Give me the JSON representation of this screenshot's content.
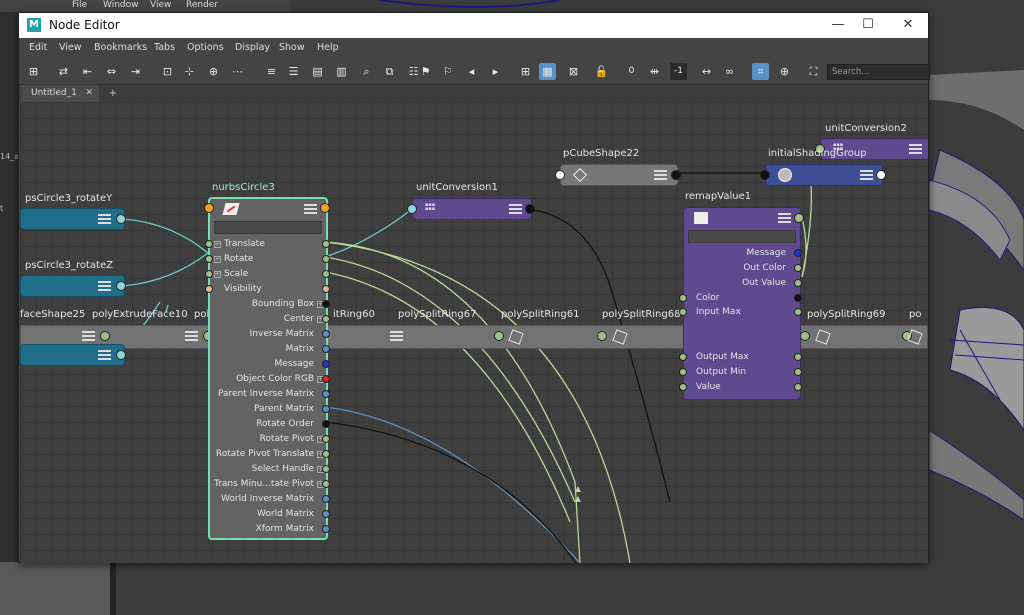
{
  "background_menu": {
    "file": "File",
    "window": "Window",
    "view": "View",
    "render": "Render"
  },
  "background_left_text": [
    "14_a",
    "t"
  ],
  "window": {
    "title": "Node Editor",
    "minimize": "—",
    "maximize": "☐",
    "close": "✕",
    "logo": "M"
  },
  "menu": [
    "Edit",
    "View",
    "Bookmarks",
    "Tabs",
    "Options",
    "Display",
    "Show",
    "Help"
  ],
  "toolbar": {
    "minus_one": "-1",
    "zero": "0",
    "search_placeholder": "Search..."
  },
  "tabs": {
    "tab1_label": "Untitled_1",
    "tab1_close": "✕",
    "add": "+"
  },
  "nodes": {
    "rotateY": "psCircle3_rotateY",
    "rotateZ": "psCircle3_rotateZ",
    "faceShape": "faceShape25",
    "extrude": "polyExtrudeFace10",
    "poly_partial": "pol",
    "nurbs": "nurbsCircle3",
    "unitConv1": "unitConversion1",
    "pCube": "pCubeShape22",
    "unitConv2": "unitConversion2",
    "initialSG": "initialShadingGroup",
    "remap": "remapValue1",
    "rings": [
      "itRing60",
      "polySplitRing67",
      "polySplitRing61",
      "polySplitRing68",
      "polySplitRing62",
      "polySplitRing69",
      "po"
    ],
    "input_min_partial": "Input Min"
  },
  "nurbs_rows": [
    {
      "label": "Translate",
      "side": "left",
      "plus": true
    },
    {
      "label": "Rotate",
      "side": "left",
      "plus": true
    },
    {
      "label": "Scale",
      "side": "left",
      "plus": true
    },
    {
      "label": "Visibility",
      "side": "left",
      "plus": false
    },
    {
      "label": "Bounding Box",
      "side": "right",
      "plus": true
    },
    {
      "label": "Center",
      "side": "right",
      "plus": true
    },
    {
      "label": "Inverse Matrix",
      "side": "right",
      "plus": false
    },
    {
      "label": "Matrix",
      "side": "right",
      "plus": false
    },
    {
      "label": "Message",
      "side": "right",
      "plus": false
    },
    {
      "label": "Object Color RGB",
      "side": "right",
      "plus": true
    },
    {
      "label": "Parent Inverse Matrix",
      "side": "right",
      "plus": false
    },
    {
      "label": "Parent Matrix",
      "side": "right",
      "plus": false
    },
    {
      "label": "Rotate Order",
      "side": "right",
      "plus": false
    },
    {
      "label": "Rotate Pivot",
      "side": "right",
      "plus": true
    },
    {
      "label": "Rotate Pivot Translate",
      "side": "right",
      "plus": true
    },
    {
      "label": "Select Handle",
      "side": "right",
      "plus": true
    },
    {
      "label": "Trans Minu...tate Pivot",
      "side": "right",
      "plus": true
    },
    {
      "label": "World Inverse Matrix",
      "side": "right",
      "plus": false
    },
    {
      "label": "World Matrix",
      "side": "right",
      "plus": false
    },
    {
      "label": "Xform Matrix",
      "side": "right",
      "plus": false
    }
  ],
  "remap_rows": [
    "Message",
    "Out Color",
    "Out Value",
    "Color",
    "Input Max",
    "Input Min",
    "Output Max",
    "Output Min",
    "Value"
  ],
  "colors": {
    "accent": "#5b8fc9",
    "selected_node": "#74e0b0",
    "purple_node": "#5f4a8f",
    "teal_node": "#1f6e8a",
    "gray_node": "#777777"
  }
}
